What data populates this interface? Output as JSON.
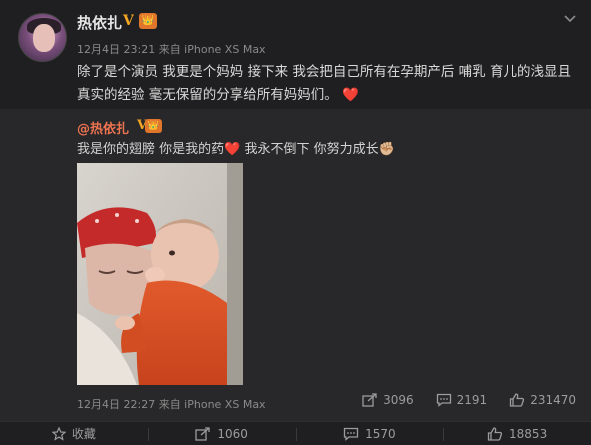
{
  "post": {
    "author": "热依扎",
    "verified_badge": "V",
    "member_badge": "👑",
    "meta": "12月4日 23:21 来自 iPhone XS Max",
    "text": "除了是个演员 我更是个妈妈 接下来 我会把自己所有在孕期产后 哺乳 育儿的浅显且真实的经验 毫无保留的分享给所有妈妈们。",
    "text_emoji": "❤️"
  },
  "repost": {
    "author": "@热依扎",
    "verified_badge": "V",
    "member_badge": "👑",
    "text_part1": "我是你的翅膀 你是我的药",
    "heart": "❤️",
    "text_part2": " 我永不倒下 你努力成长",
    "fist": "✊🏼",
    "meta": "12月4日 22:27 来自 iPhone XS Max",
    "stats": {
      "reposts": "3096",
      "comments": "2191",
      "likes": "231470"
    }
  },
  "footer": {
    "favorite": "收藏",
    "reposts": "1060",
    "comments": "1570",
    "likes": "18853"
  },
  "icons": {
    "chevron": "chevron-down-icon",
    "repost": "repost-icon",
    "comment": "comment-icon",
    "like": "thumbs-up-icon",
    "favorite": "star-icon"
  },
  "colors": {
    "background": "#1f1f21",
    "repost_bg": "#28282a",
    "repost_author": "#eb7350",
    "verified": "#f5a623",
    "heart": "#e8242e"
  }
}
